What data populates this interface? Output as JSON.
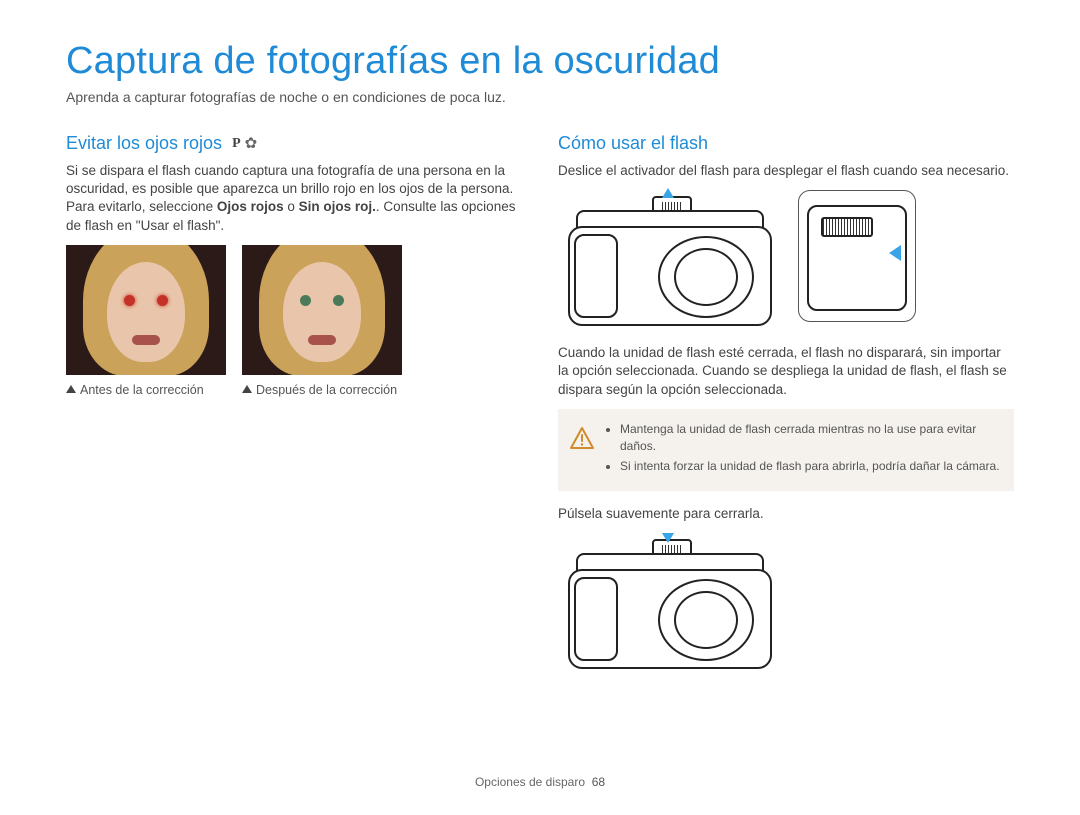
{
  "page": {
    "title": "Captura de fotografías en la oscuridad",
    "intro": "Aprenda a capturar fotografías de noche o en condiciones de poca luz."
  },
  "left": {
    "heading": "Evitar los ojos rojos",
    "modes": {
      "p": "P",
      "flower_alt": "modo flor"
    },
    "para_pre": "Si se dispara el flash cuando captura una fotografía de una persona en la oscuridad, es posible que aparezca un brillo rojo en los ojos de la persona. Para evitarlo, seleccione ",
    "para_bold1": "Ojos rojos",
    "para_mid": " o ",
    "para_bold2": "Sin ojos roj.",
    "para_post": ". Consulte las opciones de flash en \"Usar el flash\".",
    "caption_before": "Antes de la corrección",
    "caption_after": "Después de la corrección"
  },
  "right": {
    "heading": "Cómo usar el flash",
    "para1": "Deslice el activador del flash para desplegar el flash cuando sea necesario.",
    "para2": "Cuando la unidad de flash esté cerrada, el flash no disparará, sin importar la opción seleccionada. Cuando se despliega la unidad de flash, el flash se dispara según la opción seleccionada.",
    "warnings": [
      "Mantenga la unidad de flash cerrada mientras no la use para evitar daños.",
      "Si intenta forzar la unidad de flash para abrirla, podría dañar la cámara."
    ],
    "para3": "Púlsela suavemente para cerrarla."
  },
  "footer": {
    "section": "Opciones de disparo",
    "page_number": "68"
  }
}
